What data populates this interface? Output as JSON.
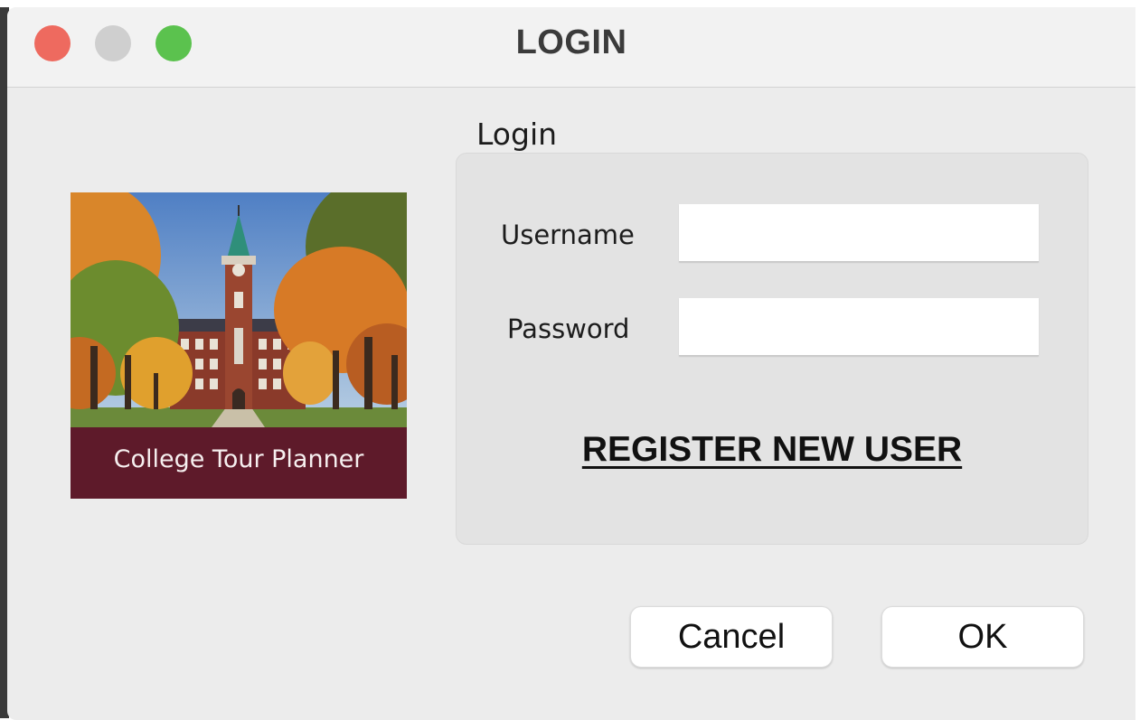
{
  "window": {
    "title": "LOGIN"
  },
  "traffic_lights": [
    {
      "name": "close-icon",
      "color": "#ee6a5f"
    },
    {
      "name": "minimize-icon",
      "color": "#cfcfcf"
    },
    {
      "name": "zoom-icon",
      "color": "#5bc24e"
    }
  ],
  "logo": {
    "caption": "College Tour Planner",
    "colors": {
      "banner": "#5e1a2a",
      "sky": "#6f8eb0",
      "foliage": "#d9862a",
      "brick": "#8a3a2a",
      "spire": "#2f8f7a",
      "lawn": "#6b8a3a"
    }
  },
  "form": {
    "group_label": "Login",
    "username": {
      "label": "Username",
      "value": "",
      "placeholder": ""
    },
    "password": {
      "label": "Password",
      "value": "",
      "placeholder": ""
    },
    "register_label": "REGISTER NEW USER"
  },
  "buttons": {
    "cancel_label": "Cancel",
    "ok_label": "OK"
  }
}
